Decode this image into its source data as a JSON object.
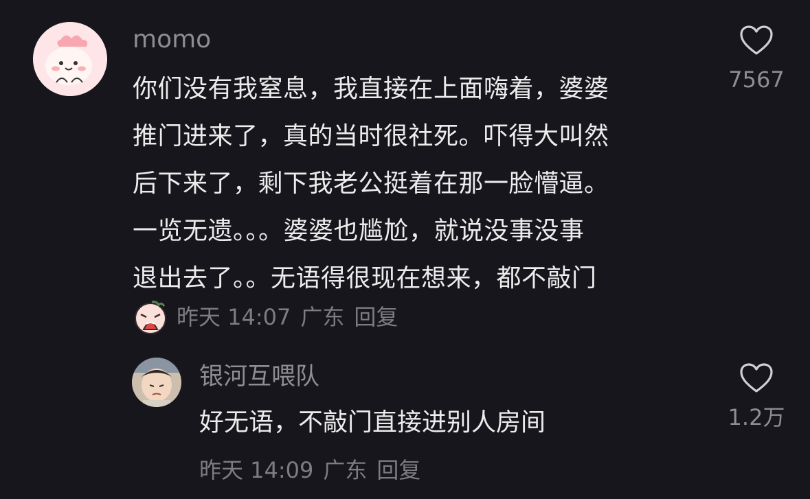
{
  "comment": {
    "username": "momo",
    "lines": [
      "你们没有我窒息，我直接在上面嗨着，婆婆",
      "推门进来了，真的当时很社死。吓得大叫然",
      "后下来了，剩下我老公挺着在那一脸懵逼。",
      "一览无遗。。。婆婆也尴尬，就说没事没事",
      "退出去了。。无语得很现在想来，都不敲门"
    ],
    "time": "昨天 14:07",
    "location": "广东",
    "reply_label": "回复",
    "like_count": "7567"
  },
  "reply": {
    "username": "银河互喂队",
    "text": "好无语，不敲门直接进别人房间",
    "time": "昨天 14:09",
    "location": "广东",
    "reply_label": "回复",
    "like_count": "1.2万"
  },
  "icons": {
    "like": "heart-outline-icon",
    "sticker": "crying-face-sticker"
  },
  "colors": {
    "background": "#17161c",
    "text": "#ececec",
    "muted": "#8e8d93"
  }
}
